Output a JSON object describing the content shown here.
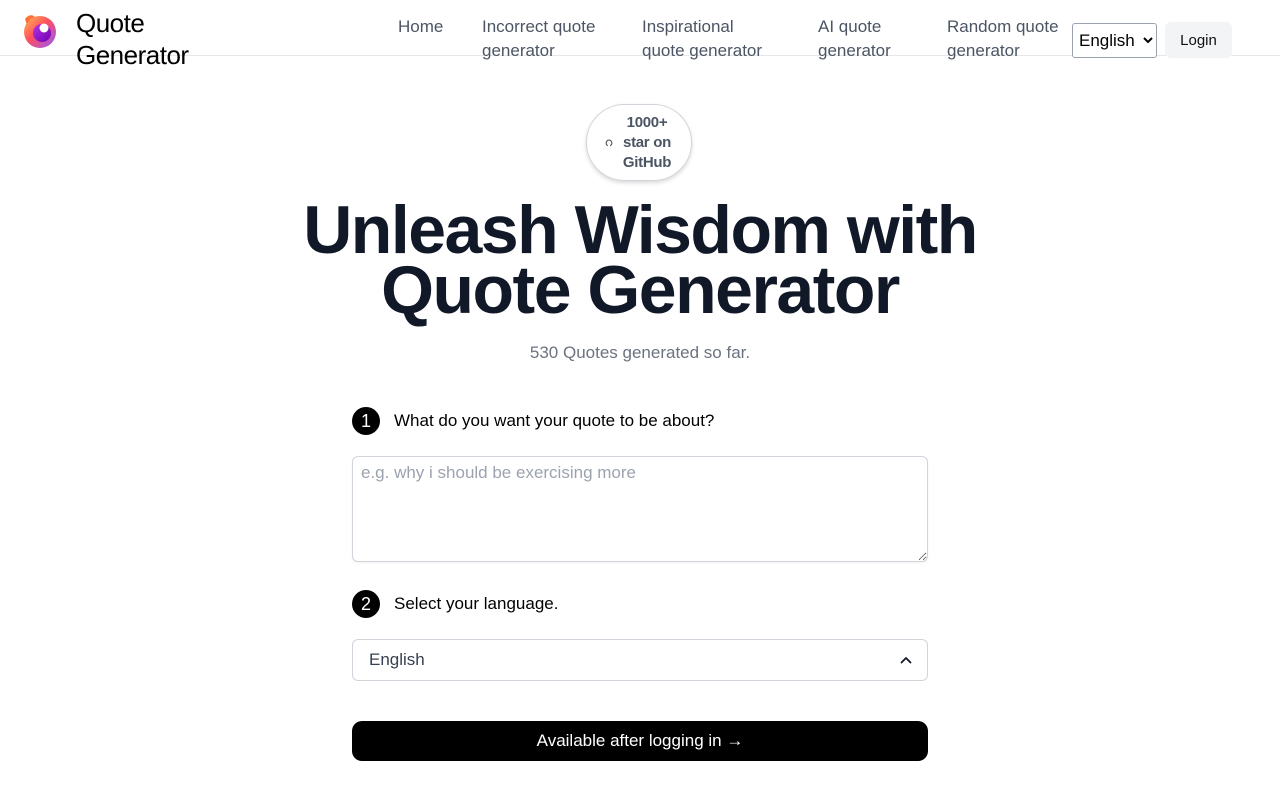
{
  "header": {
    "brand": "Quote Generator",
    "nav": [
      {
        "label": "Home"
      },
      {
        "label": "Incorrect quote generator"
      },
      {
        "label": "Inspirational quote generator"
      },
      {
        "label": "AI quote generator"
      },
      {
        "label": "Random quote generator"
      }
    ],
    "language_selected": "English",
    "login_label": "Login"
  },
  "badge": {
    "text": "1000+ star on GitHub"
  },
  "hero": {
    "title": "Unleash Wisdom with Quote Generator",
    "counter": "530 Quotes generated so far."
  },
  "form": {
    "step1": {
      "number": "1",
      "label": "What do you want your quote to be about?"
    },
    "topic_value": "",
    "topic_placeholder": "e.g. why i should be exercising more",
    "step2": {
      "number": "2",
      "label": "Select your language."
    },
    "language_value": "English",
    "submit_label": "Available after logging in →"
  },
  "icons": {
    "logo": "firefox-like-logo",
    "badge": "github-icon",
    "dropdown": "chevron-up-icon"
  },
  "colors": {
    "primary": "#000000",
    "title": "#111827",
    "muted": "#6b7280",
    "nav": "#4b5563",
    "border": "#d1d5db"
  }
}
